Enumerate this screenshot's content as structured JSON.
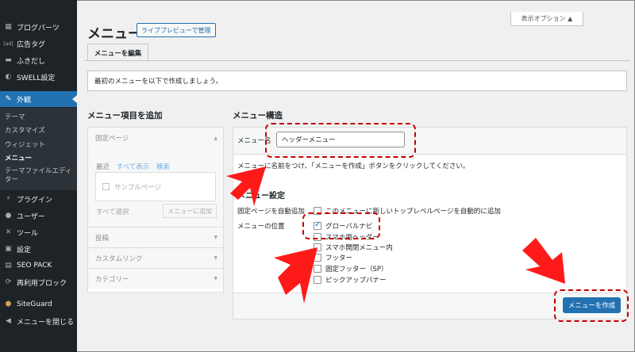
{
  "sidebar": {
    "items": [
      {
        "label": "ブログパーツ",
        "icon": "posts-icon"
      },
      {
        "label": "広告タグ",
        "icon": "tag-icon"
      },
      {
        "label": "ふきだし",
        "icon": "balloon-icon"
      },
      {
        "label": "SWELL設定",
        "icon": "swell-icon"
      },
      {
        "label": "外観",
        "icon": "brush-icon"
      },
      {
        "label": "プラグイン",
        "icon": "plugin-icon"
      },
      {
        "label": "ユーザー",
        "icon": "user-icon"
      },
      {
        "label": "ツール",
        "icon": "wrench-icon"
      },
      {
        "label": "設定",
        "icon": "settings-icon"
      },
      {
        "label": "SEO PACK",
        "icon": "seo-icon"
      },
      {
        "label": "再利用ブロック",
        "icon": "reuse-icon"
      },
      {
        "label": "SiteGuard",
        "icon": "guard-icon"
      },
      {
        "label": "メニューを閉じる",
        "icon": "collapse-icon"
      }
    ],
    "submenu": [
      "テーマ",
      "カスタマイズ",
      "ウィジェット",
      "メニュー",
      "テーマファイルエディ",
      "ター"
    ]
  },
  "header": {
    "screen_options": "表示オプション ▲",
    "title": "メニュー",
    "live_preview": "ライブプレビューで管理",
    "tab_edit": "メニューを編集"
  },
  "notice": "最初のメニューを以下で作成しましょう。",
  "left": {
    "heading": "メニュー項目を追加",
    "fixed_page": "固定ページ",
    "tab_recent": "最近",
    "tab_all": "すべて表示",
    "tab_search": "検索",
    "sample_page": "サンプルページ",
    "select_all": "すべて選択",
    "add_to_menu": "メニューに追加",
    "posts": "投稿",
    "custom_link": "カスタムリンク",
    "category": "カテゴリー"
  },
  "structure": {
    "heading": "メニュー構造",
    "name_label": "メニュー名",
    "name_value": "ヘッダーメニュー",
    "hint": "メニューに名前をつけ、「メニューを作成」ボタンをクリックしてください。",
    "settings_heading": "メニュー設定",
    "auto_add_label": "固定ページを自動追加",
    "auto_add_text": "このメニューに新しいトップレベルページを自動的に追加",
    "location_label": "メニューの位置",
    "locations": [
      {
        "label": "グローバルナビ",
        "checked": true
      },
      {
        "label": "スマホ用ヘッダー",
        "checked": false
      },
      {
        "label": "スマホ開閉メニュー内",
        "checked": false
      },
      {
        "label": "フッター",
        "checked": false
      },
      {
        "label": "固定フッター（SP）",
        "checked": false
      },
      {
        "label": "ピックアップバナー",
        "checked": false
      }
    ],
    "create_button": "メニューを作成"
  },
  "colors": {
    "accent": "#2271b1",
    "sidebar": "#1d2327",
    "annotation": "#ff0000"
  }
}
